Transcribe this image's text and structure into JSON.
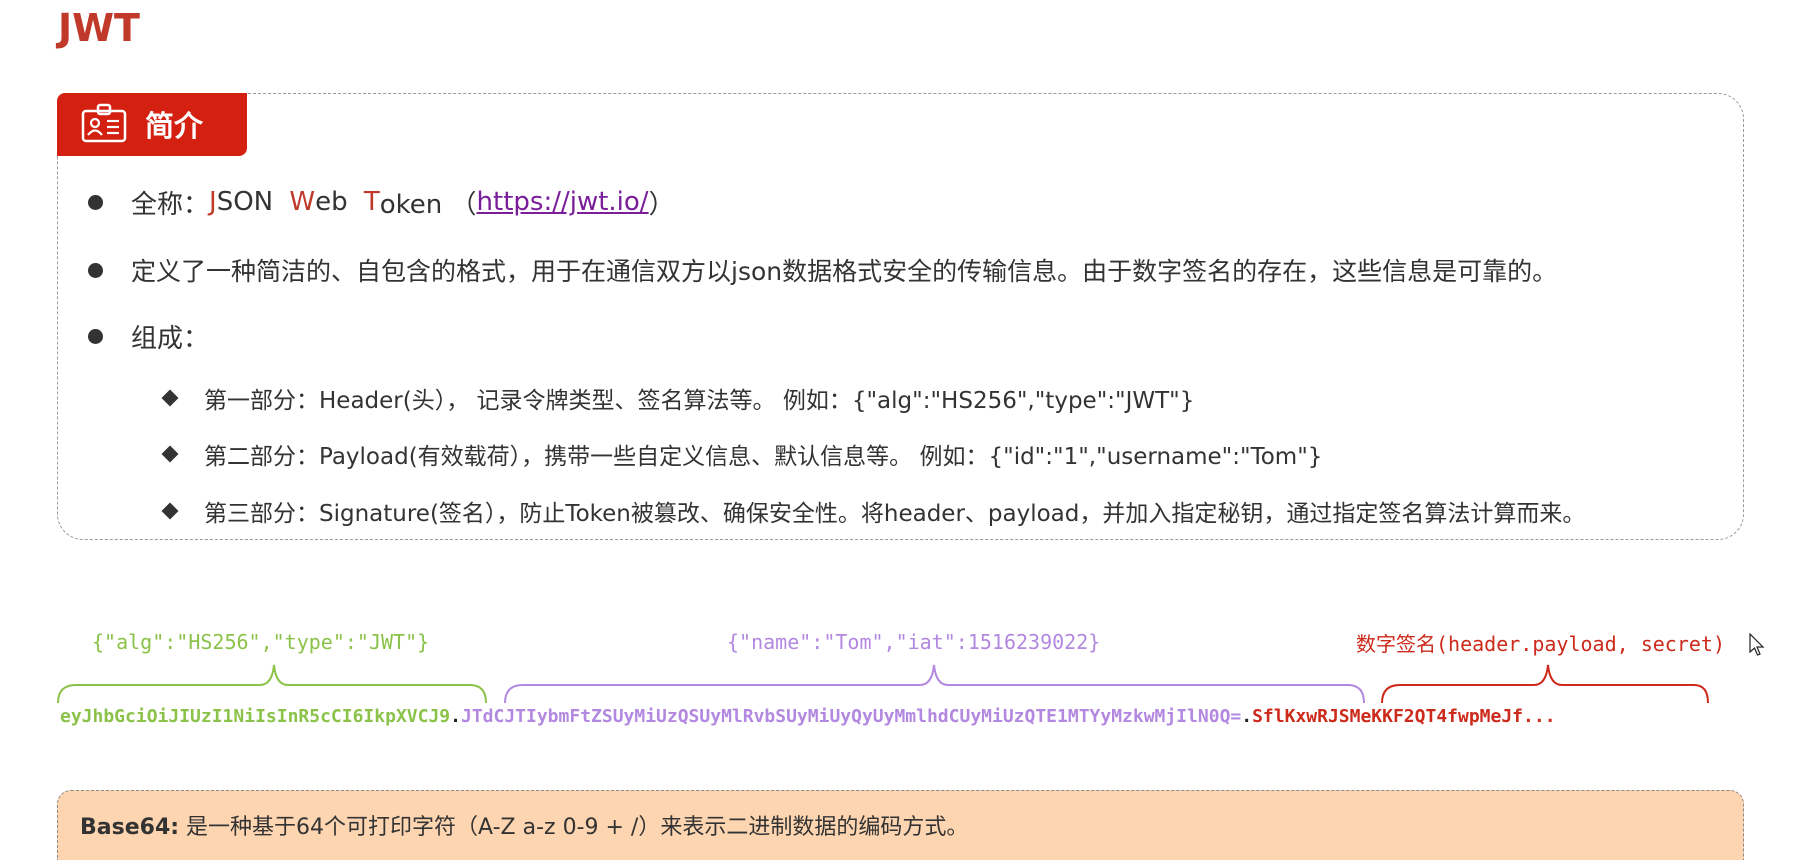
{
  "title": "JWT",
  "intro": {
    "tab_label": "简介",
    "tab_icon": "id-card-icon",
    "fullname": {
      "prefix": "全称：",
      "j": "J",
      "son": "SON ",
      "w": "W",
      "eb": "eb ",
      "t": "T",
      "oken": "oken （",
      "link": "https://jwt.io/",
      "suffix": "）"
    },
    "definition": "定义了一种简洁的、自包含的格式，用于在通信双方以json数据格式安全的传输信息。由于数字签名的存在，这些信息是可靠的。",
    "composition_label": "组成：",
    "parts": [
      "第一部分：Header(头），  记录令牌类型、签名算法等。 例如：{\"alg\":\"HS256\",\"type\":\"JWT\"}",
      "第二部分：Payload(有效载荷），携带一些自定义信息、默认信息等。 例如：{\"id\":\"1\",\"username\":\"Tom\"}",
      "第三部分：Signature(签名），防止Token被篡改、确保安全性。将header、payload，并加入指定秘钥，通过指定签名算法计算而来。"
    ]
  },
  "token_diagram": {
    "header_label": "{\"alg\":\"HS256\",\"type\":\"JWT\"}",
    "payload_label": "{\"name\":\"Tom\",\"iat\":1516239022}",
    "signature_label": "数字签名(header.payload, secret)",
    "header_part": "eyJhbGciOiJIUzI1NiIsInR5cCI6IkpXVCJ9",
    "dot1": ".",
    "payload_part": "JTdCJTIybmFtZSUyMiUzQSUyMlRvbSUyMiUyQyUyMmlhdCUyMiUzQTE1MTYyMzkwMjIlN0Q=",
    "dot2": ".",
    "signature_part": "SflKxwRJSMeKKF2QT4fwpMeJf...",
    "colors": {
      "header": "#8bc34a",
      "payload": "#b388e0",
      "signature": "#cc2a1a"
    }
  },
  "base64": {
    "label": "Base64:",
    "text": " 是一种基于64个可打印字符（A-Z a-z 0-9 + /）来表示二进制数据的编码方式。"
  }
}
